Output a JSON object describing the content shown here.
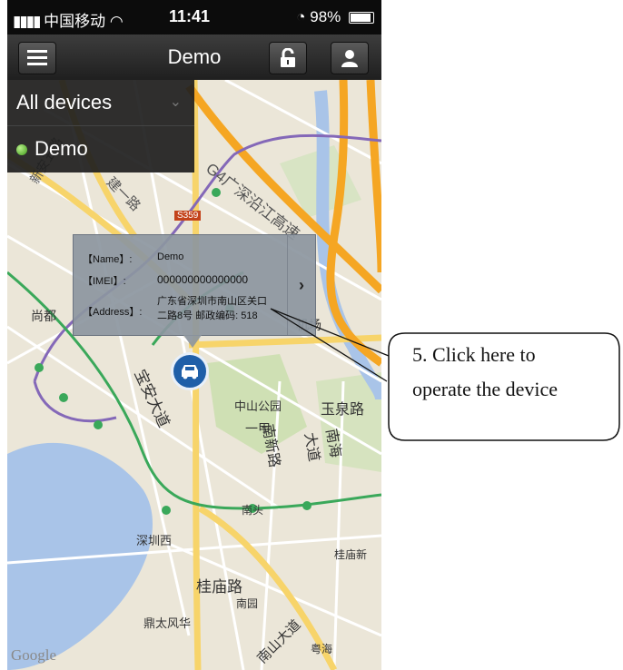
{
  "status_bar": {
    "carrier": "中国移动",
    "time": "11:41",
    "battery": "98%"
  },
  "nav": {
    "title": "Demo",
    "menu_icon": "menu-icon",
    "lock_icon": "unlock-icon",
    "user_icon": "user-icon"
  },
  "dropdown": {
    "header": "All devices",
    "item": "Demo"
  },
  "popup": {
    "name_label": "【Name】:",
    "name_value": "Demo",
    "imei_label": "【IMEI】:",
    "imei_value": "000000000000000",
    "address_label": "【Address】:",
    "address_line1": "广东省深圳市南山区关口",
    "address_line2": "二路8号 邮政编码: 518"
  },
  "map_labels": {
    "s359": "S359",
    "g4": "G4广深沿江高速",
    "airport": "机场",
    "shangdu": "尚都",
    "zhongshan": "中山公园",
    "yuquan": "玉泉路",
    "nanhaidadao": "南海大道",
    "baoan": "宝安大道",
    "nanxin": "南新路",
    "nantou": "南头",
    "shenzhenxi": "深圳西",
    "guimiao": "桂庙路",
    "nanyuan": "南园",
    "guimiaoxin": "桂庙新",
    "dingtai": "鼎太风华",
    "nanshandadao": "南山大道",
    "yuehai": "粤海",
    "yijia": "一甲",
    "xin_an": "新安五路",
    "jianyi": "建一路"
  },
  "attribution": "Google",
  "annotation": {
    "line1": "5. Click here to",
    "line2": "operate the device"
  }
}
